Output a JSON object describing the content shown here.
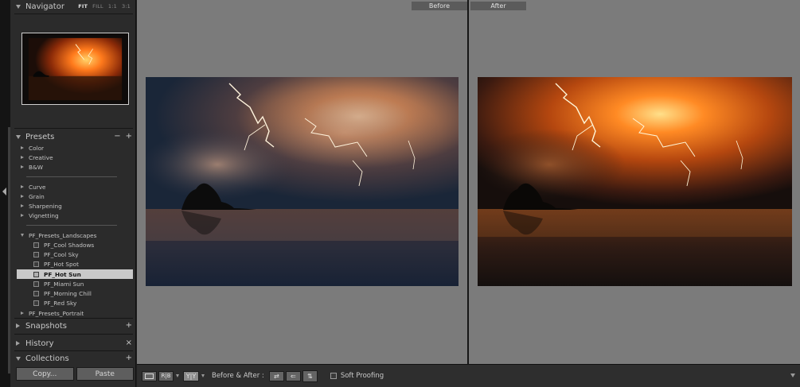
{
  "colors": {
    "selected_row": "#c9c9c9",
    "panel_bg": "#2b2b2b",
    "main_bg": "#7b7b7b"
  },
  "navigator": {
    "title": "Navigator",
    "options": [
      "FIT",
      "FILL",
      "1:1",
      "3:1"
    ],
    "selected_option": "FIT"
  },
  "presets": {
    "title": "Presets",
    "minus": "−",
    "plus": "+",
    "items": [
      {
        "label": "Color"
      },
      {
        "label": "Creative"
      },
      {
        "label": "B&W"
      },
      {
        "label": "Curve"
      },
      {
        "label": "Grain"
      },
      {
        "label": "Sharpening"
      },
      {
        "label": "Vignetting"
      },
      {
        "label": "PF_Presets_Landscapes"
      },
      {
        "label": "PF_Cool Shadows"
      },
      {
        "label": "PF_Cool Sky"
      },
      {
        "label": "PF_Hot Spot"
      },
      {
        "label": "PF_Hot Sun"
      },
      {
        "label": "PF_Miami Sun"
      },
      {
        "label": "PF_Morning Chill"
      },
      {
        "label": "PF_Red Sky"
      },
      {
        "label": "PF_Presets_Portrait"
      }
    ]
  },
  "snapshots": {
    "title": "Snapshots",
    "plus": "+"
  },
  "history": {
    "title": "History",
    "close": "×"
  },
  "collections": {
    "title": "Collections",
    "plus": "+"
  },
  "buttons": {
    "copy": "Copy...",
    "paste": "Paste"
  },
  "view": {
    "before_label": "Before",
    "after_label": "After"
  },
  "toolbar": {
    "loupe_icon": "loupe-view-icon",
    "compare_icon": "compare-view-icon",
    "yy_label": "Y|Y",
    "before_after_label": "Before & After :",
    "soft_proofing_label": "Soft Proofing"
  }
}
